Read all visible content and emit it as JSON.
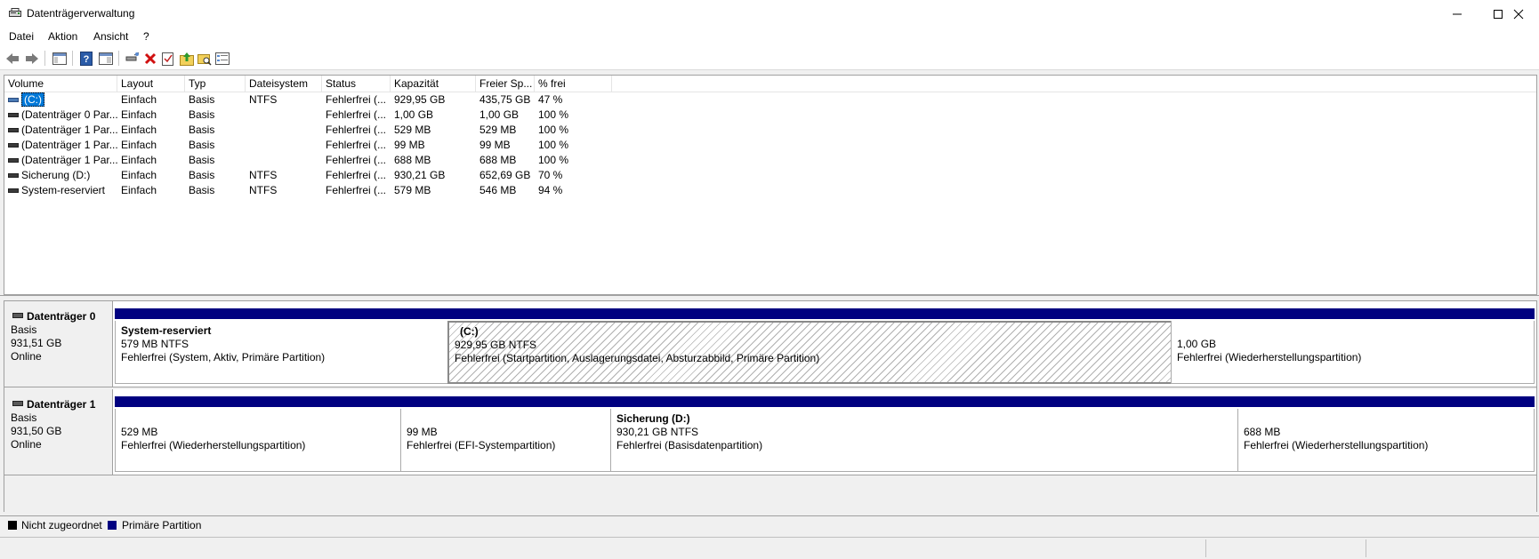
{
  "window": {
    "title": "Datenträgerverwaltung"
  },
  "menu": [
    "Datei",
    "Aktion",
    "Ansicht",
    "?"
  ],
  "toolbar": {
    "icons": [
      "back-icon",
      "forward-icon",
      "console-tree-icon",
      "help-icon",
      "show-hide-icon",
      "connect-icon",
      "delete-icon",
      "properties-icon",
      "export-icon",
      "search-icon",
      "settings-icon"
    ]
  },
  "table": {
    "columns": [
      "Volume",
      "Layout",
      "Typ",
      "Dateisystem",
      "Status",
      "Kapazität",
      "Freier Sp...",
      "% frei"
    ],
    "rows": [
      [
        "(C:)",
        "Einfach",
        "Basis",
        "NTFS",
        "Fehlerfrei (...",
        "929,95 GB",
        "435,75 GB",
        "47 %"
      ],
      [
        "(Datenträger 0 Par...",
        "Einfach",
        "Basis",
        "",
        "Fehlerfrei (...",
        "1,00 GB",
        "1,00 GB",
        "100 %"
      ],
      [
        "(Datenträger 1 Par...",
        "Einfach",
        "Basis",
        "",
        "Fehlerfrei (...",
        "529 MB",
        "529 MB",
        "100 %"
      ],
      [
        "(Datenträger 1 Par...",
        "Einfach",
        "Basis",
        "",
        "Fehlerfrei (...",
        "99 MB",
        "99 MB",
        "100 %"
      ],
      [
        "(Datenträger 1 Par...",
        "Einfach",
        "Basis",
        "",
        "Fehlerfrei (...",
        "688 MB",
        "688 MB",
        "100 %"
      ],
      [
        "Sicherung (D:)",
        "Einfach",
        "Basis",
        "NTFS",
        "Fehlerfrei (...",
        "930,21 GB",
        "652,69 GB",
        "70 %"
      ],
      [
        "System-reserviert",
        "Einfach",
        "Basis",
        "NTFS",
        "Fehlerfrei (...",
        "579 MB",
        "546 MB",
        "94 %"
      ]
    ]
  },
  "disks": [
    {
      "name": "Datenträger 0",
      "type": "Basis",
      "size": "931,51 GB",
      "state": "Online",
      "partitions": [
        {
          "title": "System-reserviert",
          "size": "579 MB NTFS",
          "status": "Fehlerfrei (System, Aktiv, Primäre Partition)"
        },
        {
          "title": "(C:)",
          "size": "929,95 GB NTFS",
          "status": "Fehlerfrei (Startpartition, Auslagerungsdatei, Absturzabbild, Primäre Partition)"
        },
        {
          "title": "",
          "size": "1,00 GB",
          "status": "Fehlerfrei (Wiederherstellungspartition)"
        }
      ]
    },
    {
      "name": "Datenträger 1",
      "type": "Basis",
      "size": "931,50 GB",
      "state": "Online",
      "partitions": [
        {
          "title": "",
          "size": "529 MB",
          "status": "Fehlerfrei (Wiederherstellungspartition)"
        },
        {
          "title": "",
          "size": "99 MB",
          "status": "Fehlerfrei (EFI-Systempartition)"
        },
        {
          "title": "Sicherung  (D:)",
          "size": "930,21 GB NTFS",
          "status": "Fehlerfrei (Basisdatenpartition)"
        },
        {
          "title": "",
          "size": "688 MB",
          "status": "Fehlerfrei (Wiederherstellungspartition)"
        }
      ]
    }
  ],
  "legend": [
    {
      "label": "Nicht zugeordnet",
      "color": "#000000"
    },
    {
      "label": "Primäre Partition",
      "color": "#000080"
    }
  ]
}
